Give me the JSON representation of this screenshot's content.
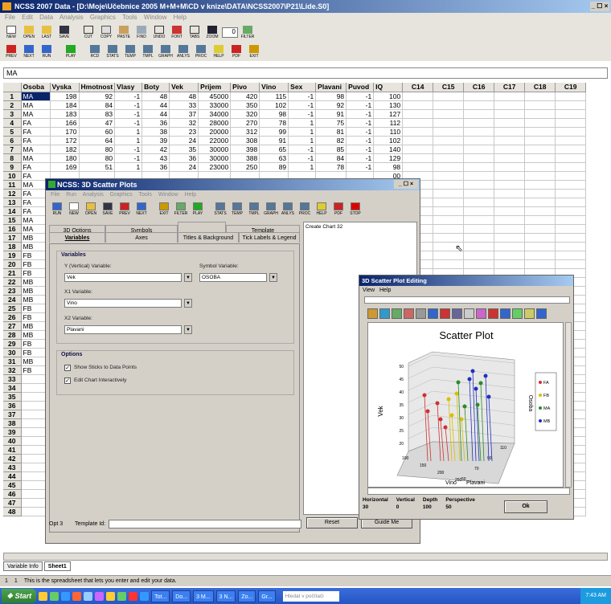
{
  "app": {
    "title": "NCSS 2007 Data - [D:\\Moje\\Učebnice 2005 M+M+M\\CD v knize\\DATA\\NCSS2007\\P21\\Lide.S0]",
    "menu": [
      "File",
      "Edit",
      "Data",
      "Analysis",
      "Graphics",
      "Tools",
      "Window",
      "Help"
    ],
    "toolbar1": [
      "NEW",
      "OPEN",
      "LAST",
      "SAVE",
      "CUT",
      "COPY",
      "PASTE",
      "FIND",
      "UNDO",
      "FONT",
      "TABS",
      "ZOOM",
      "FILTER"
    ],
    "toolbar1_field": "0",
    "toolbar2": [
      "PREV",
      "NEXT",
      "RUN",
      "PLAY",
      "RCD",
      "STATS",
      "TEMP",
      "TMPL",
      "GRAPH",
      "ANLYS",
      "PROC",
      "HELP",
      "PDF",
      "EXIT"
    ],
    "formula_bar_value": "MA",
    "columns": [
      "Osoba",
      "Vyska",
      "Hmotnost",
      "Vlasy",
      "Boty",
      "Vek",
      "Prijem",
      "Pivo",
      "Vino",
      "Sex",
      "Plavani",
      "Puvod",
      "IQ",
      "C14",
      "C15",
      "C16",
      "C17",
      "C18",
      "C19"
    ],
    "rows": [
      [
        "MA",
        "198",
        "92",
        "-1",
        "48",
        "48",
        "45000",
        "420",
        "115",
        "-1",
        "98",
        "-1",
        "100"
      ],
      [
        "MA",
        "184",
        "84",
        "-1",
        "44",
        "33",
        "33000",
        "350",
        "102",
        "-1",
        "92",
        "-1",
        "130"
      ],
      [
        "MA",
        "183",
        "83",
        "-1",
        "44",
        "37",
        "34000",
        "320",
        "98",
        "-1",
        "91",
        "-1",
        "127"
      ],
      [
        "FA",
        "166",
        "47",
        "-1",
        "36",
        "32",
        "28000",
        "270",
        "78",
        "1",
        "75",
        "-1",
        "112"
      ],
      [
        "FA",
        "170",
        "60",
        "1",
        "38",
        "23",
        "20000",
        "312",
        "99",
        "1",
        "81",
        "-1",
        "110"
      ],
      [
        "FA",
        "172",
        "64",
        "1",
        "39",
        "24",
        "22000",
        "308",
        "91",
        "1",
        "82",
        "-1",
        "102"
      ],
      [
        "MA",
        "182",
        "80",
        "-1",
        "42",
        "35",
        "30000",
        "398",
        "65",
        "-1",
        "85",
        "-1",
        "140"
      ],
      [
        "MA",
        "180",
        "80",
        "-1",
        "43",
        "36",
        "30000",
        "388",
        "63",
        "-1",
        "84",
        "-1",
        "129"
      ],
      [
        "FA",
        "169",
        "51",
        "1",
        "36",
        "24",
        "23000",
        "250",
        "89",
        "1",
        "78",
        "-1",
        "98"
      ],
      [
        "FA",
        "",
        "",
        "",
        "",
        "",
        "",
        "",
        "",
        "",
        "",
        "",
        "00"
      ],
      [
        "MA",
        "",
        "",
        "",
        "",
        "",
        "",
        "",
        "",
        "",
        "",
        "",
        "05"
      ],
      [
        "FA",
        "",
        "",
        "",
        "",
        "",
        "",
        "",
        "",
        "",
        "",
        "",
        "07"
      ],
      [
        "FA",
        "",
        "",
        "",
        "",
        "",
        "",
        "",
        "",
        "",
        "",
        "",
        "01"
      ],
      [
        "FA",
        "",
        "",
        "",
        "",
        "",
        "",
        "",
        "",
        "",
        "",
        "",
        "08"
      ],
      [
        "MA",
        "",
        "",
        "",
        "",
        "",
        "",
        "",
        "",
        "",
        "",
        "",
        "09"
      ],
      [
        "MA",
        "",
        "",
        "",
        "",
        "",
        "",
        "",
        "",
        "",
        "",
        "",
        "13"
      ],
      [
        "MB",
        "",
        "",
        "",
        "",
        "",
        "",
        "",
        "",
        "",
        "",
        "",
        "09"
      ],
      [
        "MB",
        "",
        "",
        "",
        "",
        "",
        "",
        "",
        "",
        "",
        "",
        "",
        ""
      ],
      [
        "FB",
        "",
        "",
        "",
        "",
        "",
        "",
        "",
        "",
        "",
        "",
        "",
        ""
      ],
      [
        "FB",
        "",
        "",
        "",
        "",
        "",
        "",
        "",
        "",
        "",
        "",
        "",
        ""
      ],
      [
        "FB",
        "",
        "",
        "",
        "",
        "",
        "",
        "",
        "",
        "",
        "",
        "",
        ""
      ],
      [
        "MB",
        "",
        "",
        "",
        "",
        "",
        "",
        "",
        "",
        "",
        "",
        "",
        ""
      ],
      [
        "MB",
        "",
        "",
        "",
        "",
        "",
        "",
        "",
        "",
        "",
        "",
        "",
        ""
      ],
      [
        "MB",
        "",
        "",
        "",
        "",
        "",
        "",
        "",
        "",
        "",
        "",
        "",
        ""
      ],
      [
        "FB",
        "",
        "",
        "",
        "",
        "",
        "",
        "",
        "",
        "",
        "",
        "",
        ""
      ],
      [
        "FB",
        "",
        "",
        "",
        "",
        "",
        "",
        "",
        "",
        "",
        "",
        "",
        ""
      ],
      [
        "MB",
        "",
        "",
        "",
        "",
        "",
        "",
        "",
        "",
        "",
        "",
        "",
        ""
      ],
      [
        "MB",
        "",
        "",
        "",
        "",
        "",
        "",
        "",
        "",
        "",
        "",
        "",
        ""
      ],
      [
        "FB",
        "",
        "",
        "",
        "",
        "",
        "",
        "",
        "",
        "",
        "",
        "",
        ""
      ],
      [
        "FB",
        "",
        "",
        "",
        "",
        "",
        "",
        "",
        "",
        "",
        "",
        "",
        ""
      ],
      [
        "MB",
        "",
        "",
        "",
        "",
        "",
        "",
        "",
        "",
        "",
        "",
        "",
        ""
      ],
      [
        "FB",
        "",
        "",
        "",
        "",
        "",
        "",
        "",
        "",
        "",
        "",
        "",
        ""
      ]
    ],
    "sheet_tabs": [
      "Variable Info",
      "Sheet1"
    ],
    "status": {
      "cell_row": "1",
      "cell_col": "1",
      "message": "This is the spreadsheet that lets you enter and edit your data."
    }
  },
  "scatter_dialog": {
    "title": "NCSS: 3D Scatter Plots",
    "menu": [
      "File",
      "Run",
      "Analysis",
      "Graphics",
      "Tools",
      "Window",
      "Help"
    ],
    "toolbar": [
      "RUN",
      "NEW",
      "OPEN",
      "SAVE",
      "PREV",
      "NEXT",
      "EXIT",
      "FILTER",
      "PLAY",
      "STATS",
      "TEMP",
      "TMPL",
      "GRAPH",
      "ANLYS",
      "PROC",
      "HELP",
      "PDF",
      "STOP"
    ],
    "tabs_row1": [
      "3D Options",
      "Symbols",
      "",
      "Template"
    ],
    "tabs_row2": [
      "Variables",
      "Axes",
      "Titles & Background",
      "Tick Labels & Legend"
    ],
    "section_variables": "Variables",
    "y_label": "Y (Vertical) Variable:",
    "y_value": "Vek",
    "symbol_label": "Symbol Variable:",
    "symbol_value": "OSOBA",
    "x1_label": "X1 Variable:",
    "x1_value": "Vino",
    "x2_label": "X2 Variable:",
    "x2_value": "Plavani",
    "section_options": "Options",
    "opt1": "Show Sticks to Data Points",
    "opt2": "Edit Chart Interactively",
    "template_list_item": "Create Chart 32",
    "bottom_opt": "Opt 3",
    "bottom_template": "Template Id:",
    "reset_button": "Reset",
    "guide_button": "Guide Me"
  },
  "editing_dialog": {
    "title": "3D Scatter Plot Editing",
    "menu": [
      "View",
      "Help"
    ],
    "chart_title": "Scatter Plot",
    "ylabel": "Vek",
    "xlabel1": "Vino",
    "xlabel2": "Plavani",
    "legend_title": "Osoba",
    "legend": [
      {
        "name": "FA",
        "color": "#d03030"
      },
      {
        "name": "FB",
        "color": "#d8c000"
      },
      {
        "name": "MA",
        "color": "#2a8a2a"
      },
      {
        "name": "MB",
        "color": "#2030c0"
      }
    ],
    "yticks": [
      "50",
      "45",
      "40",
      "35",
      "30",
      "25",
      "20"
    ],
    "vino_ticks": [
      "50",
      "70",
      "90",
      "110"
    ],
    "plavani_ticks": [
      "100",
      "150",
      "200",
      "250"
    ],
    "controls": [
      {
        "label": "Horizontal",
        "value": "30"
      },
      {
        "label": "Vertical",
        "value": "0"
      },
      {
        "label": "Depth",
        "value": "100"
      },
      {
        "label": "Perspective",
        "value": "50"
      }
    ],
    "ok_button": "Ok"
  },
  "taskbar": {
    "start": "Start",
    "tasks": [
      "Tot...",
      "Do...",
      "3 M...",
      "3 N...",
      "Zo...",
      "Gr..."
    ],
    "search_placeholder": "Hledat v počítači",
    "clock": "7:43 AM"
  }
}
